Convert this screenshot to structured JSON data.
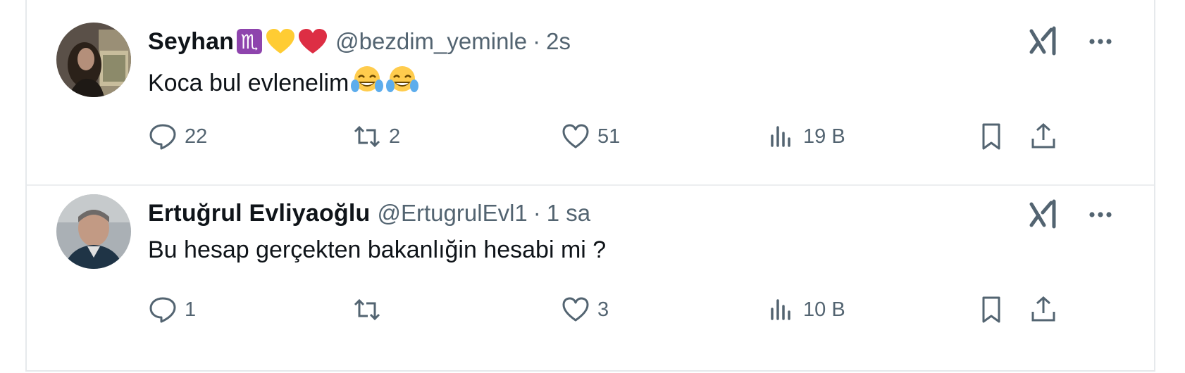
{
  "tweets": [
    {
      "name": "Seyhan",
      "name_emojis": [
        "scorpio-sign",
        "yellow-heart",
        "red-heart"
      ],
      "handle": "@bezdim_yeminle",
      "separator": "·",
      "time": "2s",
      "text": "Koca bul evlenelim",
      "text_emojis": [
        "laughing-tears",
        "laughing-tears"
      ],
      "actions": {
        "replies": "22",
        "retweets": "2",
        "likes": "51",
        "views": "19 B"
      }
    },
    {
      "name": "Ertuğrul Evliyaoğlu",
      "name_emojis": [],
      "handle": "@ErtugrulEvl1",
      "separator": "·",
      "time": "1 sa",
      "text": "Bu hesap gerçekten bakanlığin hesabi mi ?",
      "text_emojis": [],
      "actions": {
        "replies": "1",
        "retweets": "",
        "likes": "3",
        "views": "10 B"
      }
    }
  ],
  "colors": {
    "muted": "#536471",
    "text": "#0f1419",
    "scorpio": "#8e44ad",
    "yellow_heart": "#ffcc33",
    "red_heart": "#dd2e44",
    "border": "#e6e9ec"
  }
}
